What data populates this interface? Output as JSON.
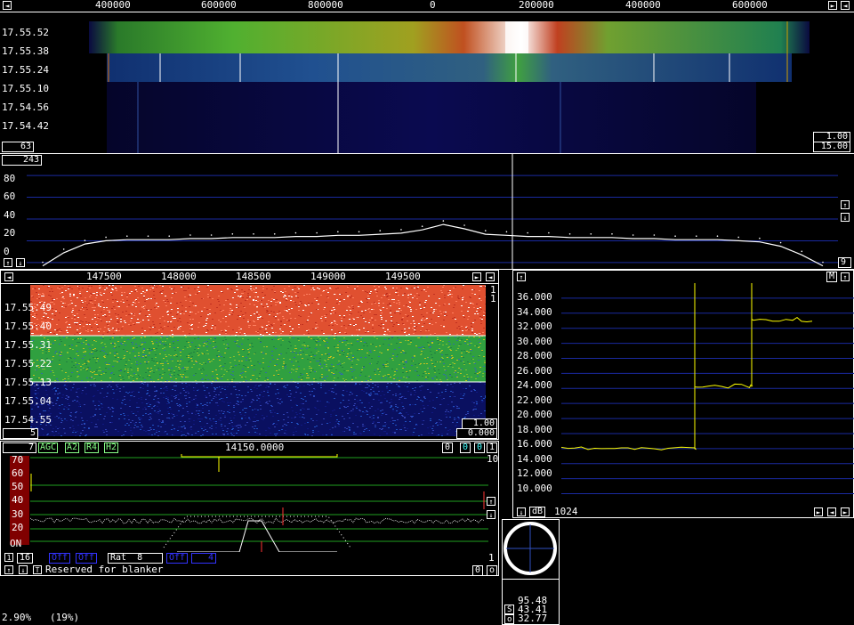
{
  "top_axis": {
    "labels": [
      "400000",
      "600000",
      "800000",
      "0",
      "200000",
      "400000",
      "600000"
    ]
  },
  "main_waterfall": {
    "time_labels": [
      "17.55.52",
      "17.55.38",
      "17.55.24",
      "17.55.10",
      "17.54.56",
      "17.54.42"
    ],
    "left_value": "63",
    "gain": "1.00",
    "zero": "15.00"
  },
  "spectrum": {
    "avg_value": "243",
    "y_labels": [
      "80",
      "60",
      "40",
      "20",
      "0"
    ],
    "right_value": "9"
  },
  "hires_axis": {
    "labels": [
      "147500",
      "148000",
      "148500",
      "149000",
      "149500"
    ]
  },
  "hires_waterfall": {
    "time_labels": [
      "17.55.49",
      "17.55.40",
      "17.55.31",
      "17.55.22",
      "17.55.13",
      "17.55.04",
      "17.54.55"
    ],
    "right_top_a": "1",
    "right_top_b": "1",
    "left_value": "5",
    "gain": "1.00",
    "zero": "0.000"
  },
  "baseband": {
    "left_value": "7",
    "toggles": [
      "AGC",
      "A2",
      "R4",
      "H2"
    ],
    "frequency": "14150.0000",
    "right_boxes": [
      "0",
      "0",
      "0",
      "1"
    ],
    "scale_right": "10",
    "y_labels": [
      "70",
      "60",
      "50",
      "40",
      "30",
      "20"
    ],
    "on_label": "ON",
    "bottom_num": "16",
    "off_a": "Off",
    "off_b": "Off",
    "rat_label": "Rat",
    "rat_value": "8",
    "off_c": "Off",
    "blue_num": "4",
    "bottom_right": "1",
    "status_text": "Reserved for blanker",
    "zero_box": "0",
    "o_box": "o"
  },
  "meter": {
    "y_labels": [
      "36.000",
      "34.000",
      "32.000",
      "30.000",
      "28.000",
      "26.000",
      "24.000",
      "22.000",
      "20.000",
      "18.000",
      "16.000",
      "14.000",
      "12.000",
      "10.000"
    ],
    "unit": "dB",
    "average": "1024",
    "m_label": "M"
  },
  "polar": {
    "values": [
      "95.48",
      "43.41",
      "32.77"
    ],
    "s_label": "S",
    "o_label": "o"
  },
  "status_bar": {
    "cpu": "2.90%",
    "load": "(19%)"
  },
  "chart_data": [
    {
      "type": "line",
      "title": "",
      "xlabel": "",
      "ylabel": "",
      "ylim": [
        0,
        90
      ],
      "series": [
        {
          "values": [
            2,
            14,
            22,
            25,
            26,
            26,
            26,
            27,
            27,
            28,
            28,
            28,
            29,
            29,
            30,
            30,
            31,
            32,
            35,
            40,
            36,
            31,
            30,
            29,
            29,
            28,
            28,
            28,
            27,
            27,
            26,
            26,
            26,
            25,
            24,
            20,
            12,
            2
          ]
        }
      ]
    },
    {
      "type": "line",
      "title": "",
      "xlabel": "",
      "ylabel": "",
      "ylim": [
        9,
        38
      ],
      "series": [
        {
          "values": [
            16,
            16,
            16,
            16,
            16,
            16,
            16,
            16,
            16,
            16,
            24.2,
            24.3,
            24.2,
            24.4,
            24.2,
            24.3,
            33.2,
            33.0,
            33.1,
            33.2,
            33.0,
            33.1
          ]
        }
      ]
    }
  ]
}
